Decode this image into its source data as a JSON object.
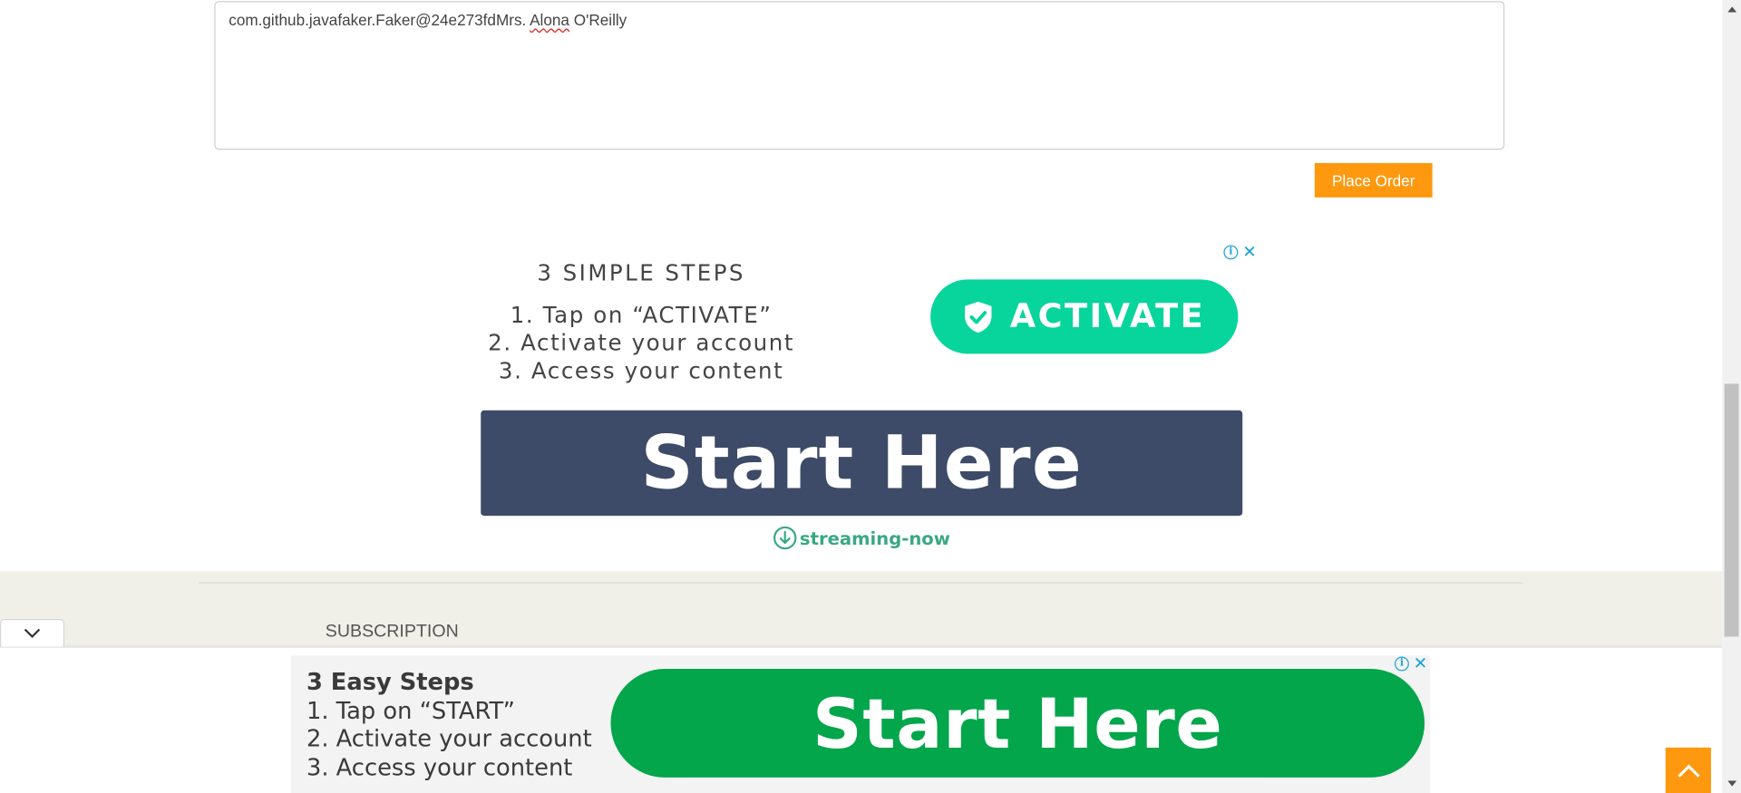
{
  "comment": {
    "text_before": "com.github.javafaker.Faker@24e273fdMrs. ",
    "misspelled_word": "Alona",
    "text_after": " O'Reilly"
  },
  "order": {
    "place_order_label": "Place Order"
  },
  "ad_top": {
    "title": "3 SIMPLE STEPS",
    "steps": [
      "1. Tap on “ACTIVATE”",
      "2. Activate your account",
      "3. Access your content"
    ],
    "activate_label": "ACTIVATE",
    "start_label": "Start Here",
    "brand": "streaming-now"
  },
  "footer": {
    "subscription_label": "SUBSCRIPTION"
  },
  "ad_bottom": {
    "title": "3 Easy Steps",
    "steps": [
      "1. Tap on “START”",
      "2. Activate your account",
      "3. Access your content"
    ],
    "start_label": "Start Here"
  },
  "colors": {
    "accent_orange": "#fe980f",
    "activate_green": "#07d59c",
    "banner_navy": "#3d4a68",
    "start_green": "#03a64a",
    "footer_bg": "#f0f0e9"
  },
  "icons": {
    "ad_info": "info-icon",
    "ad_close": "close-icon",
    "shield": "shield-check-icon",
    "download": "download-circle-icon",
    "collapse": "chevron-down-icon",
    "scroll_top": "chevron-up-icon"
  }
}
